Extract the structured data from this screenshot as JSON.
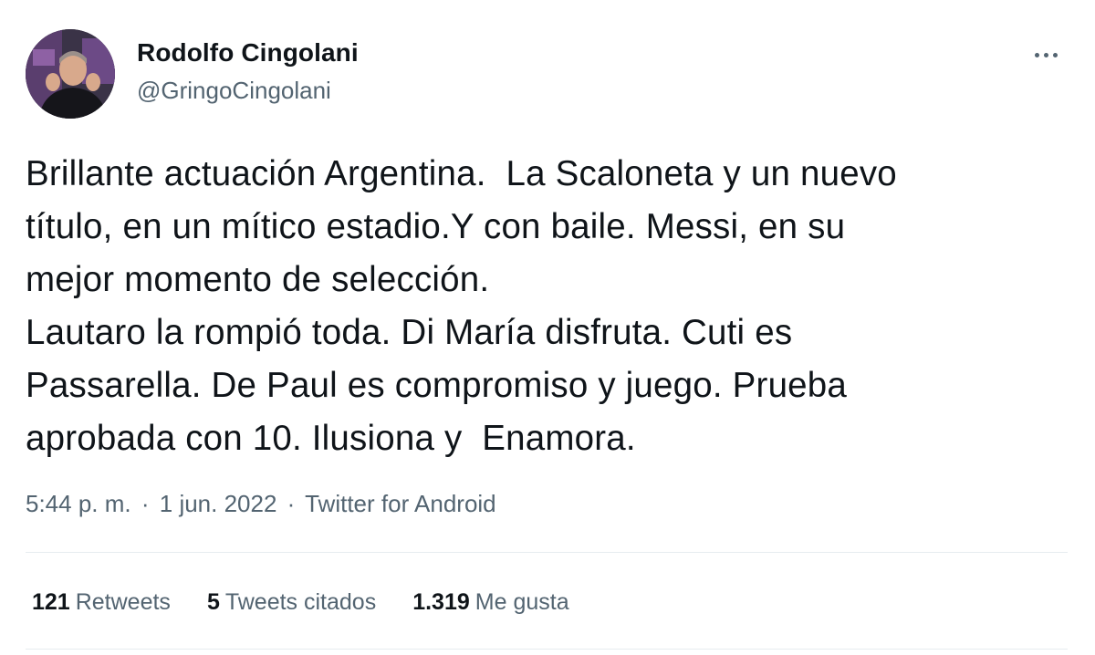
{
  "author": {
    "display_name": "Rodolfo Cingolani",
    "handle": "@GringoCingolani"
  },
  "more_icon": "more-horizontal-icon",
  "tweet_text": "Brillante actuación Argentina.  La Scaloneta y un nuevo\ntítulo, en un mítico estadio.Y con baile. Messi, en su\nmejor momento de selección.\nLautaro la rompió toda. Di María disfruta. Cuti es\nPassarella. De Paul es compromiso y juego. Prueba\naprobada con 10. Ilusiona y  Enamora.",
  "meta": {
    "time": "5:44 p. m.",
    "separator": "·",
    "date": "1 jun. 2022",
    "source": "Twitter for Android"
  },
  "stats": {
    "retweets_count": "121",
    "retweets_label": "Retweets",
    "quotes_count": "5",
    "quotes_label": "Tweets citados",
    "likes_count": "1.319",
    "likes_label": "Me gusta"
  },
  "colors": {
    "text_primary": "#0f1419",
    "text_secondary": "#536471",
    "divider": "#e6ecf0"
  }
}
